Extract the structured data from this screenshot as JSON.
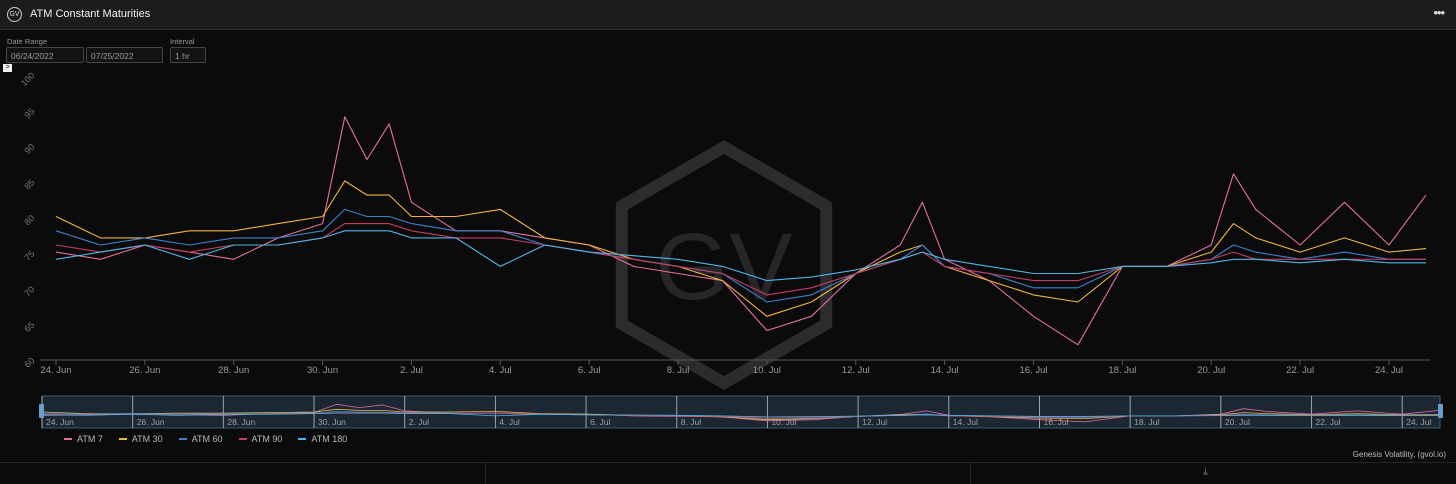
{
  "header": {
    "title": "ATM Constant Maturities",
    "logo_text": "GV",
    "menu_icon": "more-horizontal-icon",
    "menu_glyph": "•••"
  },
  "controls": {
    "date_range_label": "Date Range",
    "start_date": "06/24/2022",
    "end_date": "07/25/2022",
    "interval_label": "Interval",
    "interval": "1 hr"
  },
  "expand_glyph": ">",
  "watermark": "GV",
  "credit": "Genesis Volatility, (gvol.io)",
  "download_glyph": "⤓",
  "chart_data": {
    "type": "line",
    "title": "ATM Constant Maturities",
    "ylim": [
      60,
      100
    ],
    "yticks": [
      60,
      65,
      70,
      75,
      80,
      85,
      90,
      95,
      100
    ],
    "xlim": [
      "2022-06-24",
      "2022-07-24T20:00"
    ],
    "xticks": [
      "24. Jun",
      "26. Jun",
      "28. Jun",
      "30. Jun",
      "2. Jul",
      "4. Jul",
      "6. Jul",
      "8. Jul",
      "10. Jul",
      "12. Jul",
      "14. Jul",
      "16. Jul",
      "18. Jul",
      "20. Jul",
      "22. Jul",
      "24. Jul"
    ],
    "grid": false,
    "legend": "bottom-left",
    "navigator": true,
    "series": [
      {
        "name": "ATM 7",
        "color": "#e46ea0",
        "x": [
          "2022-06-24",
          "2022-06-25",
          "2022-06-26",
          "2022-06-27",
          "2022-06-28",
          "2022-06-29",
          "2022-06-30",
          "2022-06-30T12:00",
          "2022-07-01",
          "2022-07-01T12:00",
          "2022-07-02",
          "2022-07-03",
          "2022-07-04",
          "2022-07-05",
          "2022-07-06",
          "2022-07-07",
          "2022-07-08",
          "2022-07-09",
          "2022-07-10",
          "2022-07-11",
          "2022-07-12",
          "2022-07-13",
          "2022-07-13T12:00",
          "2022-07-14",
          "2022-07-15",
          "2022-07-16",
          "2022-07-17",
          "2022-07-18",
          "2022-07-19",
          "2022-07-20",
          "2022-07-20T12:00",
          "2022-07-21",
          "2022-07-22",
          "2022-07-23",
          "2022-07-24",
          "2022-07-24T20:00"
        ],
        "values": [
          75,
          74,
          76,
          75,
          74,
          77,
          79,
          94,
          88,
          93,
          82,
          78,
          78,
          77,
          76,
          73,
          72,
          71,
          64,
          66,
          72,
          76,
          82,
          74,
          71,
          66,
          62,
          73,
          73,
          76,
          86,
          81,
          76,
          82,
          76,
          83
        ]
      },
      {
        "name": "ATM 30",
        "color": "#f0b43c",
        "x": [
          "2022-06-24",
          "2022-06-25",
          "2022-06-26",
          "2022-06-27",
          "2022-06-28",
          "2022-06-29",
          "2022-06-30",
          "2022-06-30T12:00",
          "2022-07-01",
          "2022-07-01T12:00",
          "2022-07-02",
          "2022-07-03",
          "2022-07-04",
          "2022-07-05",
          "2022-07-06",
          "2022-07-07",
          "2022-07-08",
          "2022-07-09",
          "2022-07-10",
          "2022-07-11",
          "2022-07-12",
          "2022-07-13",
          "2022-07-13T12:00",
          "2022-07-14",
          "2022-07-15",
          "2022-07-16",
          "2022-07-17",
          "2022-07-18",
          "2022-07-19",
          "2022-07-20",
          "2022-07-20T12:00",
          "2022-07-21",
          "2022-07-22",
          "2022-07-23",
          "2022-07-24",
          "2022-07-24T20:00"
        ],
        "values": [
          80,
          77,
          77,
          78,
          78,
          79,
          80,
          85,
          83,
          83,
          80,
          80,
          81,
          77,
          76,
          74,
          73,
          71,
          66,
          68,
          72,
          75,
          76,
          73,
          71,
          69,
          68,
          73,
          73,
          75,
          79,
          77,
          75,
          77,
          75,
          75.5
        ]
      },
      {
        "name": "ATM 60",
        "color": "#3b82c8",
        "x": [
          "2022-06-24",
          "2022-06-25",
          "2022-06-26",
          "2022-06-27",
          "2022-06-28",
          "2022-06-29",
          "2022-06-30",
          "2022-06-30T12:00",
          "2022-07-01",
          "2022-07-01T12:00",
          "2022-07-02",
          "2022-07-03",
          "2022-07-04",
          "2022-07-05",
          "2022-07-06",
          "2022-07-07",
          "2022-07-08",
          "2022-07-09",
          "2022-07-10",
          "2022-07-11",
          "2022-07-12",
          "2022-07-13",
          "2022-07-13T12:00",
          "2022-07-14",
          "2022-07-15",
          "2022-07-16",
          "2022-07-17",
          "2022-07-18",
          "2022-07-19",
          "2022-07-20",
          "2022-07-20T12:00",
          "2022-07-21",
          "2022-07-22",
          "2022-07-23",
          "2022-07-24",
          "2022-07-24T20:00"
        ],
        "values": [
          78,
          76,
          77,
          76,
          77,
          77,
          78,
          81,
          80,
          80,
          79,
          78,
          78,
          76,
          75,
          74,
          73,
          72,
          68,
          69,
          72,
          74,
          76,
          73,
          72,
          70,
          70,
          73,
          73,
          74,
          76,
          75,
          74,
          75,
          74,
          74
        ]
      },
      {
        "name": "ATM 90",
        "color": "#c43c64",
        "x": [
          "2022-06-24",
          "2022-06-25",
          "2022-06-26",
          "2022-06-27",
          "2022-06-28",
          "2022-06-29",
          "2022-06-30",
          "2022-06-30T12:00",
          "2022-07-01",
          "2022-07-01T12:00",
          "2022-07-02",
          "2022-07-03",
          "2022-07-04",
          "2022-07-05",
          "2022-07-06",
          "2022-07-07",
          "2022-07-08",
          "2022-07-09",
          "2022-07-10",
          "2022-07-11",
          "2022-07-12",
          "2022-07-13",
          "2022-07-13T12:00",
          "2022-07-14",
          "2022-07-15",
          "2022-07-16",
          "2022-07-17",
          "2022-07-18",
          "2022-07-19",
          "2022-07-20",
          "2022-07-20T12:00",
          "2022-07-21",
          "2022-07-22",
          "2022-07-23",
          "2022-07-24",
          "2022-07-24T20:00"
        ],
        "values": [
          76,
          75,
          76,
          75,
          76,
          76,
          77,
          79,
          79,
          79,
          78,
          77,
          77,
          76,
          75,
          74,
          73,
          72,
          69,
          70,
          72,
          74,
          75,
          73,
          72,
          71,
          71,
          73,
          73,
          74,
          75,
          74,
          74,
          74,
          74,
          74
        ]
      },
      {
        "name": "ATM 180",
        "color": "#4eb6e6",
        "x": [
          "2022-06-24",
          "2022-06-25",
          "2022-06-26",
          "2022-06-27",
          "2022-06-28",
          "2022-06-29",
          "2022-06-30",
          "2022-06-30T12:00",
          "2022-07-01",
          "2022-07-01T12:00",
          "2022-07-02",
          "2022-07-03",
          "2022-07-04",
          "2022-07-05",
          "2022-07-06",
          "2022-07-07",
          "2022-07-08",
          "2022-07-09",
          "2022-07-10",
          "2022-07-11",
          "2022-07-12",
          "2022-07-13",
          "2022-07-13T12:00",
          "2022-07-14",
          "2022-07-15",
          "2022-07-16",
          "2022-07-17",
          "2022-07-18",
          "2022-07-19",
          "2022-07-20",
          "2022-07-20T12:00",
          "2022-07-21",
          "2022-07-22",
          "2022-07-23",
          "2022-07-24",
          "2022-07-24T20:00"
        ],
        "values": [
          74,
          75,
          76,
          74,
          76,
          76,
          77,
          78,
          78,
          78,
          77,
          77,
          73,
          76,
          75,
          74.5,
          74,
          73,
          71,
          71.5,
          72.5,
          74,
          75,
          74,
          73,
          72,
          72,
          73,
          73,
          73.5,
          74,
          74,
          73.5,
          74,
          73.5,
          73.5
        ]
      }
    ]
  }
}
